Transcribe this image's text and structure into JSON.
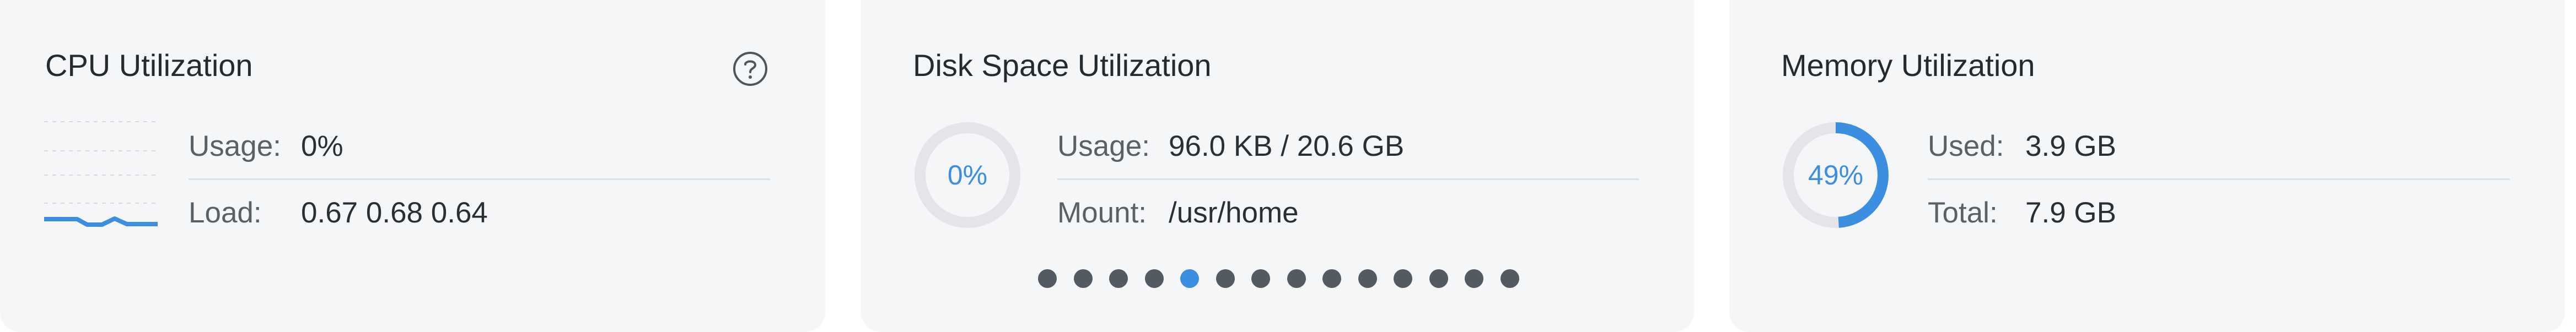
{
  "cpu": {
    "title": "CPU Utilization",
    "usage_label": "Usage:",
    "usage_value": "0%",
    "load_label": "Load:",
    "load_value": "0.67 0.68 0.64",
    "help_icon": "question-circle-icon"
  },
  "disk": {
    "title": "Disk Space Utilization",
    "percent_text": "0%",
    "percent": 0,
    "usage_label": "Usage:",
    "usage_value": "96.0 KB / 20.6 GB",
    "mount_label": "Mount:",
    "mount_value": "/usr/home",
    "pager": {
      "count": 14,
      "active_index": 4
    }
  },
  "memory": {
    "title": "Memory Utilization",
    "percent_text": "49%",
    "percent": 49,
    "used_label": "Used:",
    "used_value": "3.9 GB",
    "total_label": "Total:",
    "total_value": "7.9 GB"
  },
  "colors": {
    "accent": "#3c8fe0",
    "card_background": "#f5f6f8",
    "ring_track": "#e3e5e8",
    "pager_dot": "#545a62"
  }
}
